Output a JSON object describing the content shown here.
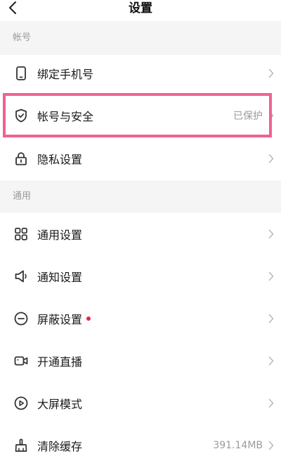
{
  "header": {
    "title": "设置"
  },
  "sections": [
    {
      "title": "帐号",
      "items": [
        {
          "label": "绑定手机号",
          "value": "",
          "icon": "phone-icon"
        },
        {
          "label": "帐号与安全",
          "value": "已保护",
          "icon": "shield-check-icon"
        },
        {
          "label": "隐私设置",
          "value": "",
          "icon": "lock-icon"
        }
      ]
    },
    {
      "title": "通用",
      "items": [
        {
          "label": "通用设置",
          "value": "",
          "icon": "grid-icon"
        },
        {
          "label": "通知设置",
          "value": "",
          "icon": "speaker-icon"
        },
        {
          "label": "屏蔽设置",
          "value": "",
          "icon": "minus-circle-icon",
          "badge_dot": true
        },
        {
          "label": "开通直播",
          "value": "",
          "icon": "video-camera-icon"
        },
        {
          "label": "大屏模式",
          "value": "",
          "icon": "play-circle-icon"
        },
        {
          "label": "清除缓存",
          "value": "391.14MB",
          "icon": "broom-icon"
        }
      ]
    }
  ],
  "colors": {
    "highlight": "#f06292",
    "badge_dot": "#e8254d",
    "section_bg": "#f5f5f5",
    "secondary_text": "#9a9a9a"
  }
}
